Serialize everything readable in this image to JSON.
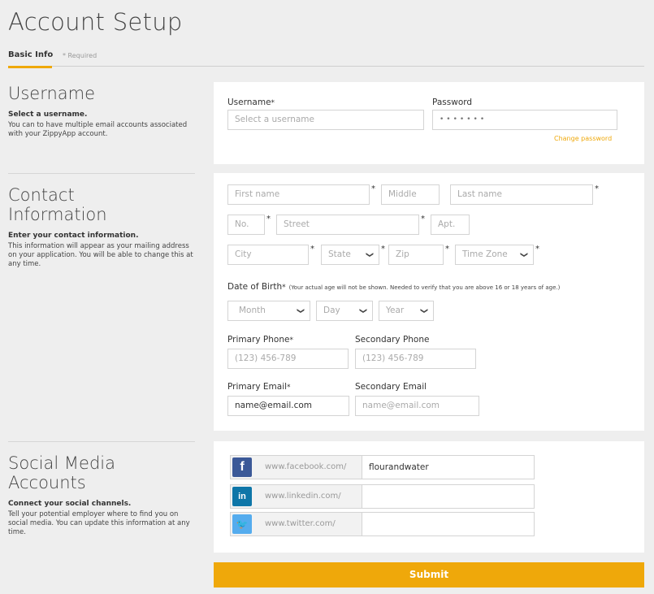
{
  "page_title": "Account Setup",
  "tabs": {
    "basic_info": "Basic Info",
    "required_note": "* Required"
  },
  "username_section": {
    "title": "Username",
    "subtitle": "Select a username.",
    "description": "You can to have multiple email accounts associated with your ZippyApp account.",
    "username_label": "Username",
    "username_placeholder": "Select a username",
    "password_label": "Password",
    "password_value": "•••••••",
    "change_password": "Change password"
  },
  "contact_section": {
    "title": "Contact Information",
    "subtitle": "Enter your contact information.",
    "description": "This information will appear as your mailing address on your application. You will be able to change this at any time.",
    "first_name_placeholder": "First name",
    "middle_placeholder": "Middle",
    "last_name_placeholder": "Last name",
    "no_placeholder": "No.",
    "street_placeholder": "Street",
    "apt_placeholder": "Apt.",
    "city_placeholder": "City",
    "state_selected": "State",
    "zip_placeholder": "Zip",
    "timezone_selected": "Time Zone",
    "dob_label": "Date of Birth",
    "dob_note": "(Your actual age will not be shown. Needed to verify that you are above 16 or 18 years of age.)",
    "month_selected": "Month",
    "day_selected": "Day",
    "year_selected": "Year",
    "primary_phone_label": "Primary Phone",
    "primary_phone_placeholder": "(123) 456-789",
    "secondary_phone_label": "Secondary Phone",
    "secondary_phone_placeholder": "(123) 456-789",
    "primary_email_label": "Primary Email",
    "primary_email_value": "name@email.com",
    "secondary_email_label": "Secondary Email",
    "secondary_email_placeholder": "name@email.com"
  },
  "social_section": {
    "title": "Social Media Accounts",
    "subtitle": "Connect your social channels.",
    "description": "Tell your potential employer where to find you on social media. You can update this information at any time.",
    "facebook": {
      "glyph": "f",
      "url": "www.facebook.com/",
      "value": "flourandwater",
      "color": "#3b5998"
    },
    "linkedin": {
      "glyph": "in",
      "url": "www.linkedin.com/",
      "value": "",
      "color": "#0e76a8"
    },
    "twitter": {
      "glyph": "🐦",
      "url": "www.twitter.com/",
      "value": "",
      "color": "#55acee"
    }
  },
  "submit_label": "Submit",
  "chevron_glyph": "❯",
  "required_mark": "*",
  "colors": {
    "accent": "#efa80a"
  }
}
